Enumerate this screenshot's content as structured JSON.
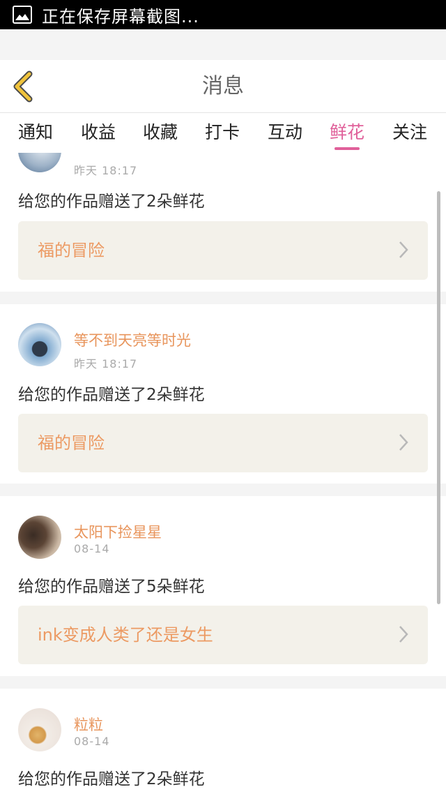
{
  "status_bar": {
    "icon": "image-icon",
    "text": "正在保存屏幕截图..."
  },
  "header": {
    "back_icon": "chevron-left-icon",
    "title": "消息"
  },
  "tabs": [
    {
      "label": "通知",
      "active": false
    },
    {
      "label": "收益",
      "active": false
    },
    {
      "label": "收藏",
      "active": false
    },
    {
      "label": "打卡",
      "active": false
    },
    {
      "label": "互动",
      "active": false
    },
    {
      "label": "鲜花",
      "active": true
    },
    {
      "label": "关注",
      "active": false
    }
  ],
  "notifications": [
    {
      "user": "",
      "time": "昨天 18:17",
      "message": "给您的作品赠送了2朵鲜花",
      "work_title": "福的冒险"
    },
    {
      "user": "等不到天亮等时光",
      "time": "昨天 18:17",
      "message": "给您的作品赠送了2朵鲜花",
      "work_title": "福的冒险"
    },
    {
      "user": "太阳下捡星星",
      "time": "08-14",
      "message": "给您的作品赠送了5朵鲜花",
      "work_title": "ink变成人类了还是女生"
    },
    {
      "user": "粒粒",
      "time": "08-14",
      "message": "给您的作品赠送了2朵鲜花",
      "work_title": ""
    }
  ],
  "colors": {
    "accent": "#e0609a",
    "name": "#e8955c",
    "work_bg": "#f3f1ea",
    "back_icon": "#f0c33c"
  }
}
